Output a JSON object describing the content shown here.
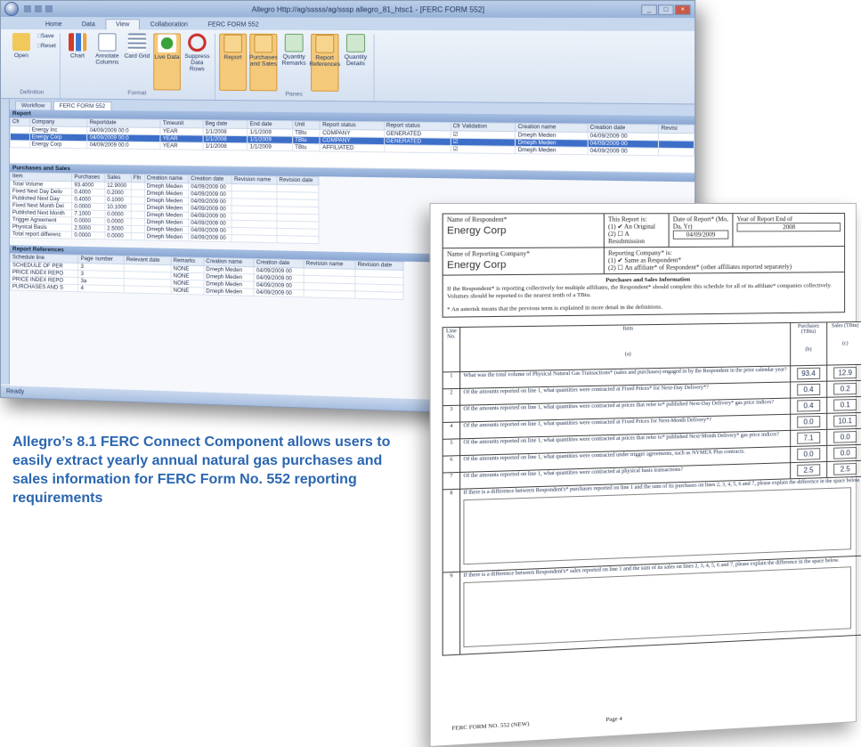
{
  "app": {
    "title": "Allegro Http://ag/sssss/ag/sssp allegro_81_htsc1 - [FERC FORM 552]",
    "tabs": [
      "Home",
      "Data",
      "View",
      "Collaboration",
      "FERC FORM 552"
    ],
    "active_tab": "View",
    "ribbon": {
      "groups": [
        {
          "label": "Definition",
          "buttons": [
            {
              "label": "Open",
              "icon": "folder-icon"
            },
            {
              "label": "Save",
              "icon": "save-icon"
            },
            {
              "label": "Reset",
              "icon": "reset-icon"
            }
          ]
        },
        {
          "label": "Format",
          "buttons": [
            {
              "label": "Chart",
              "icon": "chart-icon"
            },
            {
              "label": "Annotate Columns",
              "icon": "annotate-icon"
            },
            {
              "label": "Card Grid",
              "icon": "card-grid-icon"
            },
            {
              "label": "Live Data",
              "icon": "live-data-icon"
            },
            {
              "label": "Suppress Data Rows",
              "icon": "suppress-icon"
            }
          ]
        },
        {
          "label": "Panes",
          "buttons": [
            {
              "label": "Report",
              "icon": "report-icon"
            },
            {
              "label": "Purchases and Sales",
              "icon": "purchases-icon"
            },
            {
              "label": "Quantity Remarks",
              "icon": "quantity-remarks-icon"
            },
            {
              "label": "Report References",
              "icon": "report-references-icon"
            },
            {
              "label": "Quantity Details",
              "icon": "quantity-details-icon"
            }
          ]
        }
      ]
    },
    "doc_tabs": [
      "Workflow",
      "FERC FORM 552"
    ],
    "report_panel": {
      "title": "Report",
      "columns": [
        "Cfr",
        "Company",
        "Reportdate",
        "Timeunit",
        "Beg date",
        "End date",
        "Unit",
        "Report status",
        "Report status",
        "Cfr Validation",
        "Creation name",
        "Creation date",
        "Revisi"
      ],
      "rows": [
        [
          "",
          "Energy Inc",
          "04/09/2009 00:0",
          "YEAR",
          "1/1/2008",
          "1/1/2009",
          "TBtu",
          "COMPANY",
          "GENERATED",
          "☑",
          "Dmeph Meden",
          "04/09/2009 00",
          ""
        ],
        [
          "",
          "Energy Corp",
          "04/09/2009 00:0",
          "YEAR",
          "1/1/2008",
          "1/1/2009",
          "TBtu",
          "COMPANY",
          "GENERATED",
          "☑",
          "Dmeph Meden",
          "04/09/2009 00",
          ""
        ],
        [
          "",
          "Energy Corp",
          "04/09/2009 00:0",
          "YEAR",
          "1/1/2008",
          "1/1/2009",
          "TBtu",
          "AFFILIATED",
          "",
          "☑",
          "Dmeph Meden",
          "04/09/2009 00",
          ""
        ]
      ],
      "selected_row": 1
    },
    "purchases_panel": {
      "title": "Purchases and Sales",
      "columns": [
        "Item",
        "Purchases",
        "Sales",
        "Ffn",
        "Creation name",
        "Creation date",
        "Revision name",
        "Revision date"
      ],
      "rows": [
        [
          "Total Volume",
          "93.4000",
          "12.9000",
          "",
          "Dmeph Meden",
          "04/09/2009 00",
          "",
          ""
        ],
        [
          "Fixed Next Day Deliv",
          "0.4000",
          "0.2000",
          "",
          "Dmeph Meden",
          "04/09/2009 00",
          "",
          ""
        ],
        [
          "Published Next Day",
          "0.4000",
          "0.1000",
          "",
          "Dmeph Meden",
          "04/09/2009 00",
          "",
          ""
        ],
        [
          "Fixed Next Month Del",
          "0.0000",
          "10.1000",
          "",
          "Dmeph Meden",
          "04/09/2009 00",
          "",
          ""
        ],
        [
          "Published Next Month",
          "7.1000",
          "0.0000",
          "",
          "Dmeph Meden",
          "04/09/2009 00",
          "",
          ""
        ],
        [
          "Trigger Agreement",
          "0.0000",
          "0.0000",
          "",
          "Dmeph Meden",
          "04/09/2009 00",
          "",
          ""
        ],
        [
          "Physical Basis",
          "2.5000",
          "2.5000",
          "",
          "Dmeph Meden",
          "04/09/2009 00",
          "",
          ""
        ],
        [
          "Total report differenc",
          "0.0000",
          "0.0000",
          "",
          "Dmeph Meden",
          "04/09/2009 00",
          "",
          ""
        ]
      ]
    },
    "references_panel": {
      "title": "Report References",
      "columns": [
        "Schedule line",
        "Page number",
        "Relevant date",
        "Remarks",
        "Creation name",
        "Creation date",
        "Revision name",
        "Revision date"
      ],
      "rows": [
        [
          "SCHEDULE OF PER",
          "3",
          "",
          "NONE",
          "Dmeph Meden",
          "04/09/2009 00",
          "",
          ""
        ],
        [
          "PRICE INDEX REPO",
          "3",
          "",
          "NONE",
          "Dmeph Meden",
          "04/09/2009 00",
          "",
          ""
        ],
        [
          "PRICE INDEX REPO",
          "3a",
          "",
          "NONE",
          "Dmeph Meden",
          "04/09/2009 00",
          "",
          ""
        ],
        [
          "PURCHASES AND S",
          "4",
          "",
          "NONE",
          "Dmeph Meden",
          "04/09/2009 00",
          "",
          ""
        ]
      ]
    },
    "status": "Ready"
  },
  "caption": "Allegro’s  8.1 FERC Connect Component allows users to easily extract yearly annual natural gas purchases and sales information for FERC Form No. 552 reporting requirements",
  "form": {
    "respondent_label": "Name of Respondent*",
    "respondent_value": "Energy Corp",
    "reporting_company_label": "Name of Reporting Company*",
    "reporting_company_value": "Energy Corp",
    "this_report_label": "This Report is:",
    "original_label": "An Original",
    "resubmission_label": "A Resubmission",
    "date_label": "Date of Report* (Mo, Da, Yr)",
    "date_value": "04/09/2009",
    "year_label": "Year of Report End of",
    "year_value": "2008",
    "reporting_company_is_label": "Reporting Company* is:",
    "same_as_label": "Same as Respondent*",
    "affiliate_label": "An affiliate* of Respondent* (other affiliates reported separately)",
    "section_title": "Purchases and Sales Information",
    "instructions": "If the Respondent* is reporting collectively for multiple affiliates, the Respondent* should complete this schedule for all of its affiliate* companies collectively.  Volumes should be reported to the nearest tenth of a TBtu.",
    "asterisk_note": "* An asterisk means that the previous term is explained in more detail in the definitions.",
    "headers": {
      "line": "Line No.",
      "item": "Item",
      "purchases": "Purchases (TBtu)",
      "sales": "Sales (TBtu)",
      "a": "(a)",
      "b": "(b)",
      "c": "(c)"
    },
    "rows": [
      {
        "line": "1",
        "item": "What was the total volume of Physical Natural Gas Transactions* (sales and purchases) engaged in by the Respondent in the prior calendar year?",
        "purchases": "93.4",
        "sales": "12.9"
      },
      {
        "line": "2",
        "item": "Of the amounts reported on line 1, what quantities were contracted at Fixed Prices* for Next-Day Delivery*?",
        "purchases": "0.4",
        "sales": "0.2"
      },
      {
        "line": "3",
        "item": "Of the amounts reported on line 1, what quantities were contracted at prices that refer to* published Next-Day Delivery* gas price indices?",
        "purchases": "0.4",
        "sales": "0.1"
      },
      {
        "line": "4",
        "item": "Of the amounts reported on line 1, what quantities were contracted at Fixed Prices for Next-Month Delivery*?",
        "purchases": "0.0",
        "sales": "10.1"
      },
      {
        "line": "5",
        "item": "Of the amounts reported on line 1, what quantities were contracted at prices that refer to* published Next-Month Delivery* gas price indices?",
        "purchases": "7.1",
        "sales": "0.0"
      },
      {
        "line": "6",
        "item": "Of the amounts reported on line 1, what quantities were contracted under trigger agreements, such as NYMEX Plus contracts.",
        "purchases": "0.0",
        "sales": "0.0"
      },
      {
        "line": "7",
        "item": "Of the amounts reported on line 1, what quantities were contracted at physical basis transactions?",
        "purchases": "2.5",
        "sales": "2.5"
      }
    ],
    "line8_no": "8",
    "line8_text": "If there is a difference between Respondent's* purchases reported on line 1 and the sum of its purchases on lines 2, 3, 4, 5, 6 and 7, please explain the difference in the space below.",
    "line9_no": "9",
    "line9_text": "If there is a difference between Respondent's* sales reported on line 1 and the sum of its sales on lines 2, 3, 4, 5, 6 and 7, please explain the difference in the space below.",
    "footer_left": "FERC FORM NO. 552 (NEW)",
    "footer_right": "Page 4"
  }
}
